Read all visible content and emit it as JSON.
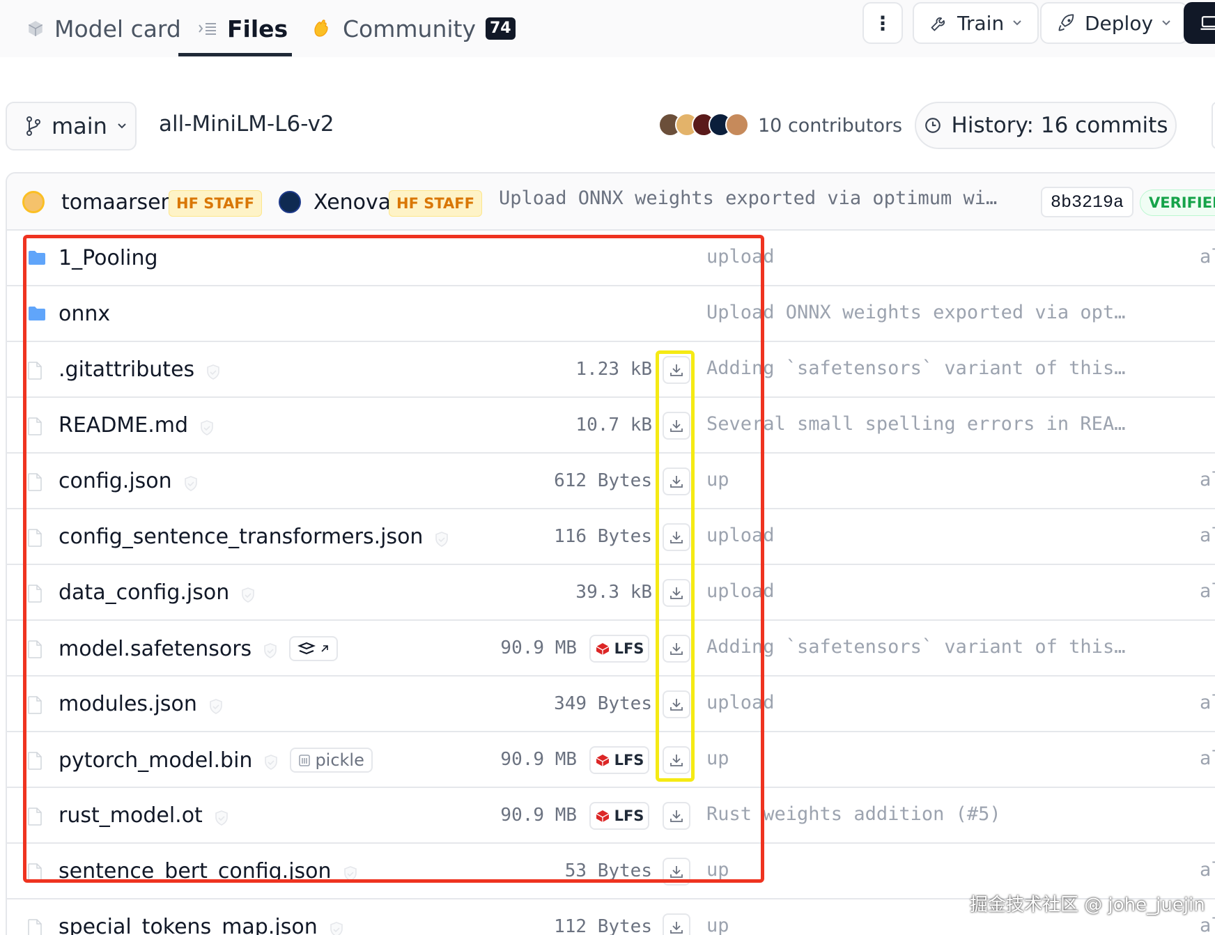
{
  "tabs": {
    "model_card": "Model card",
    "files": "Files",
    "community": "Community",
    "community_count": "74"
  },
  "toolbar": {
    "more": "⋮",
    "train": "Train",
    "deploy": "Deploy"
  },
  "repo": {
    "branch": "main",
    "name": "all-MiniLM-L6-v2",
    "contributors": "10 contributors",
    "history": "History: 16 commits"
  },
  "last_commit": {
    "author1": "tomaarsen",
    "author1_badge": "HF STAFF",
    "author2": "Xenova",
    "author2_badge": "HF STAFF",
    "message": "Upload ONNX weights exported via optimum wi…",
    "sha": "8b3219a",
    "status": "VERIFIED"
  },
  "files": [
    {
      "name": "1_Pooling",
      "kind": "folder",
      "size": "",
      "lfs": "",
      "tag": "",
      "message": "upload",
      "date": "al"
    },
    {
      "name": "onnx",
      "kind": "folder",
      "size": "",
      "lfs": "",
      "tag": "",
      "message": "Upload ONNX weights exported via opt…",
      "date": ""
    },
    {
      "name": ".gitattributes",
      "kind": "file",
      "size": "1.23 kB",
      "lfs": "",
      "tag": "",
      "message": "Adding `safetensors` variant of this…",
      "date": ""
    },
    {
      "name": "README.md",
      "kind": "file",
      "size": "10.7 kB",
      "lfs": "",
      "tag": "",
      "message": "Several small spelling errors in REA…",
      "date": ""
    },
    {
      "name": "config.json",
      "kind": "file",
      "size": "612 Bytes",
      "lfs": "",
      "tag": "",
      "message": "up",
      "date": "al"
    },
    {
      "name": "config_sentence_transformers.json",
      "kind": "file",
      "size": "116 Bytes",
      "lfs": "",
      "tag": "",
      "message": "upload",
      "date": "al"
    },
    {
      "name": "data_config.json",
      "kind": "file",
      "size": "39.3 kB",
      "lfs": "",
      "tag": "",
      "message": "upload",
      "date": "al"
    },
    {
      "name": "model.safetensors",
      "kind": "file",
      "size": "90.9 MB",
      "lfs": "LFS",
      "tag": "safetensors",
      "message": "Adding `safetensors` variant of this…",
      "date": ""
    },
    {
      "name": "modules.json",
      "kind": "file",
      "size": "349 Bytes",
      "lfs": "",
      "tag": "",
      "message": "upload",
      "date": "al"
    },
    {
      "name": "pytorch_model.bin",
      "kind": "file",
      "size": "90.9 MB",
      "lfs": "LFS",
      "tag": "pickle",
      "message": "up",
      "date": "al"
    },
    {
      "name": "rust_model.ot",
      "kind": "file",
      "size": "90.9 MB",
      "lfs": "LFS",
      "tag": "",
      "message": "Rust weights addition (#5)",
      "date": ""
    },
    {
      "name": "sentence_bert_config.json",
      "kind": "file",
      "size": "53 Bytes",
      "lfs": "",
      "tag": "",
      "message": "up",
      "date": "al"
    },
    {
      "name": "special_tokens_map.json",
      "kind": "file",
      "size": "112 Bytes",
      "lfs": "",
      "tag": "",
      "message": "up",
      "date": "al"
    }
  ],
  "watermark": "掘金技术社区 @ johe_juejin",
  "colors": {
    "annotation_red": "#ef3320",
    "annotation_yellow": "#f5ea14",
    "folder": "#60a5fa",
    "staff_badge": "#d97706",
    "verified": "#16a34a"
  }
}
